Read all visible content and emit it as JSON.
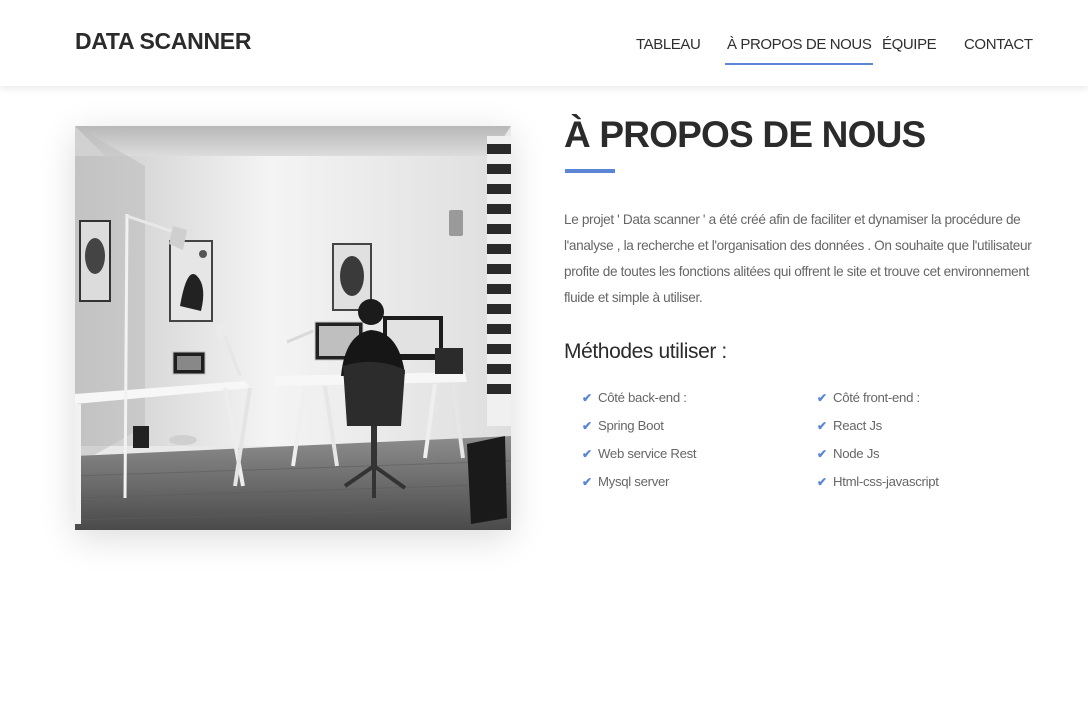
{
  "brand": "DATA SCANNER",
  "nav": {
    "items": [
      {
        "label": "TABLEAU"
      },
      {
        "label": "À PROPOS DE NOUS",
        "active": true
      },
      {
        "label": "ÉQUIPE"
      },
      {
        "label": "CONTACT"
      }
    ]
  },
  "about": {
    "title": "À PROPOS DE NOUS",
    "description": "Le projet ' Data scanner ' a été créé afin de faciliter et dynamiser la procédure de l'analyse , la recherche et l'organisation des données . On souhaite que l'utilisateur profite de toutes les fonctions alitées qui offrent le site et trouve cet environnement fluide et simple à utiliser.",
    "methods_title": "Méthodes utiliser :",
    "left_list": [
      "Côté back-end :",
      "Spring Boot",
      "Web service Rest",
      "Mysql server"
    ],
    "right_list": [
      "Côté front-end :",
      "React Js",
      "Node Js",
      "Html-css-javascript"
    ]
  },
  "colors": {
    "accent": "#5b86d6",
    "heading": "#2b2b2b",
    "body_text": "#666666"
  },
  "icons": {
    "list_bullet": "check-icon"
  }
}
